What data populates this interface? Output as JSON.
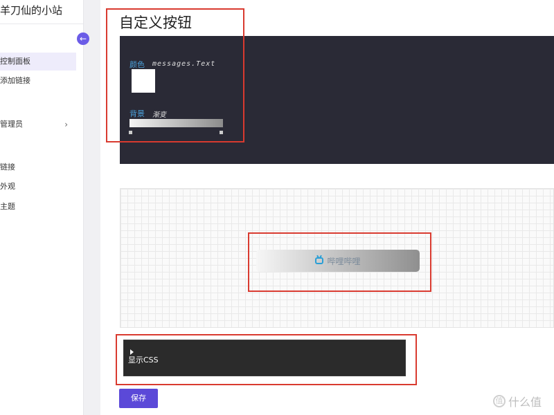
{
  "sidebar": {
    "site_title": "羊刀仙的小站",
    "collapse_icon": "arrow-left-icon",
    "items": [
      {
        "label": "控制面板",
        "active": true
      },
      {
        "label": "添加链接"
      },
      {
        "label": "管理员",
        "has_chevron": true
      },
      {
        "label": "链接"
      },
      {
        "label": "外观"
      },
      {
        "label": "主题"
      }
    ]
  },
  "page": {
    "title": "自定义按钮"
  },
  "editor": {
    "color_label": "颜色",
    "color_value": "messages.Text",
    "swatch_color": "#ffffff",
    "background_label": "背景",
    "background_value": "渐变",
    "gradient": [
      "#f4f4f4",
      "#8c8c8c"
    ]
  },
  "preview": {
    "button_label": "哔哩哔哩",
    "button_icon": "bilibili-tv-icon"
  },
  "css_toggle": {
    "label": "显示CSS"
  },
  "actions": {
    "save_label": "保存"
  },
  "watermark": {
    "text": "什么值",
    "icon_char": "值"
  },
  "colors": {
    "accent": "#5b49d8",
    "highlight": "#d93a2f",
    "dark_panel": "#2a2a36",
    "label_blue": "#4a9fd8"
  }
}
